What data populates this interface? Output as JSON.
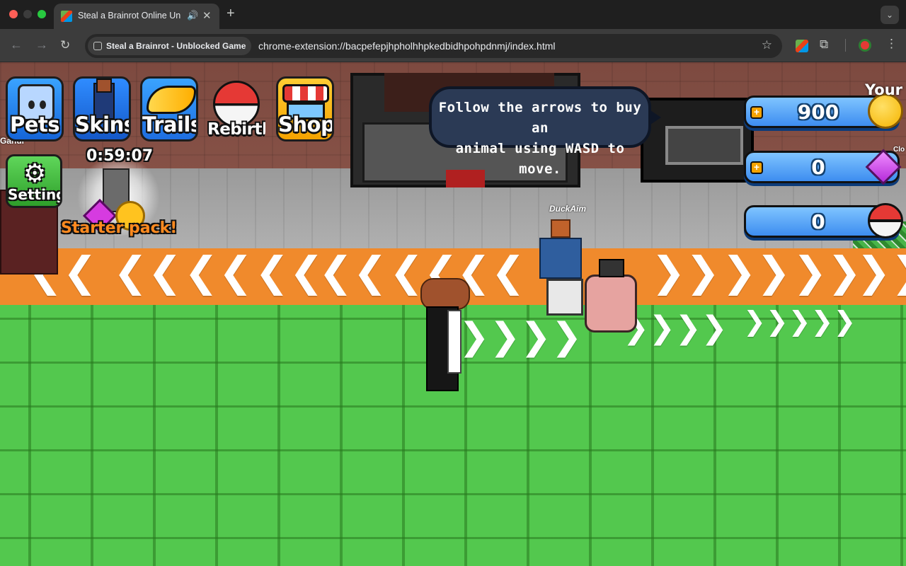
{
  "browser": {
    "tab_title": "Steal a Brainrot Online Un",
    "site_chip": "Steal a Brainrot - Unblocked Game",
    "url": "chrome-extension://bacpefepjhpholhhpkedbidhpohpdnmj/index.html"
  },
  "icons": {
    "back": "back-arrow-icon",
    "forward": "forward-arrow-icon",
    "reload": "reload-icon",
    "star": "bookmark-star-icon",
    "extensions": "puzzle-icon",
    "menu": "kebab-menu-icon",
    "audio": "speaker-icon"
  },
  "hud": {
    "buttons": {
      "pets": "Pets",
      "skins": "Skins",
      "trails": "Trails",
      "rebirth": "Rebirth",
      "shop": "Shop",
      "settings": "Settings"
    },
    "starter_pack": {
      "timer": "0:59:07",
      "label": "Starter pack!"
    },
    "tutorial": {
      "line1": "Follow the arrows to buy an",
      "line2": "animal using WASD to move."
    },
    "currency": {
      "coins": "900",
      "gems": "0",
      "rebirths": "0"
    }
  },
  "world": {
    "player_tags": {
      "left_edge": "Ganur",
      "duckaim": "DuckAim",
      "right_edge": "Clo"
    },
    "corner_text": "Your"
  },
  "colors": {
    "path_orange": "#f08a2c",
    "grass_green": "#53c84e",
    "currency_blue": "#3d8df0"
  }
}
